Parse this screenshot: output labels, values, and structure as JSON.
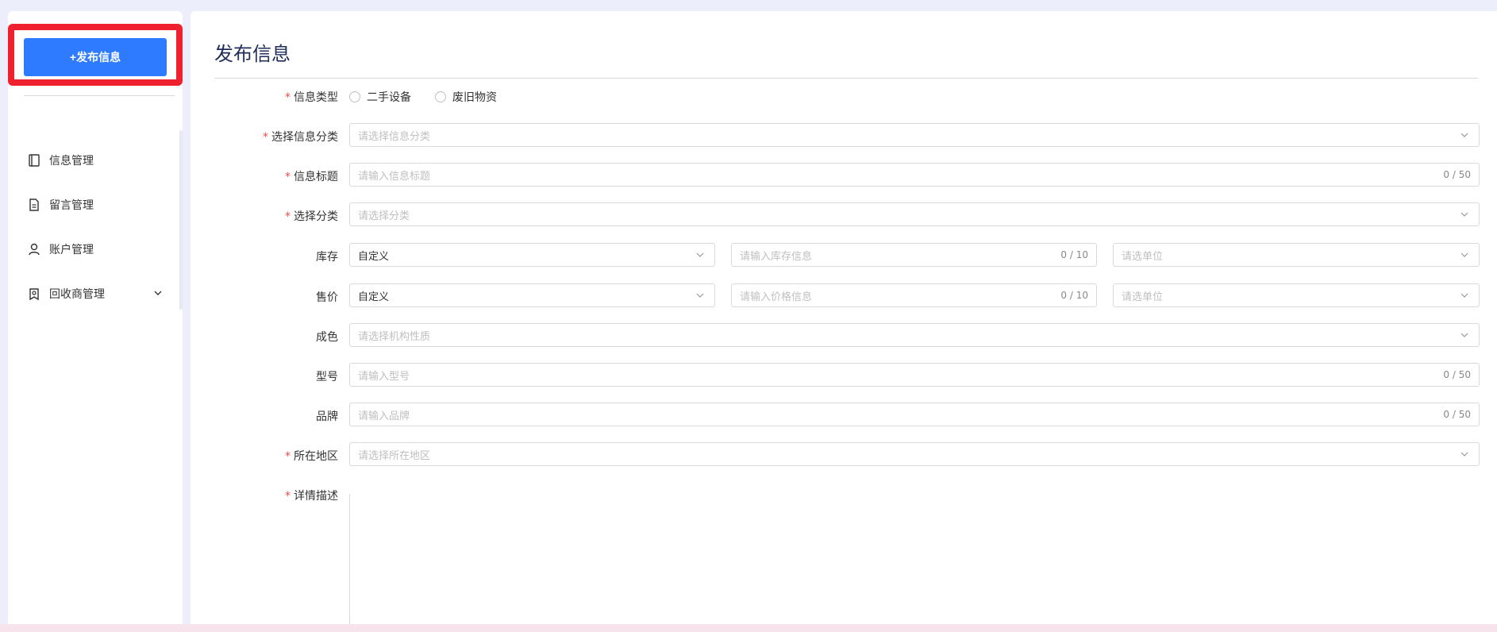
{
  "sidebar": {
    "publish_label": "+发布信息",
    "items": [
      {
        "label": "信息管理",
        "icon": "book-icon"
      },
      {
        "label": "留言管理",
        "icon": "document-icon"
      },
      {
        "label": "账户管理",
        "icon": "user-icon"
      },
      {
        "label": "回收商管理",
        "icon": "badge-icon",
        "has_submenu": true
      }
    ]
  },
  "main": {
    "title": "发布信息",
    "form": {
      "info_type": {
        "label": "信息类型",
        "required": true,
        "options": [
          "二手设备",
          "废旧物资"
        ]
      },
      "info_category": {
        "label": "选择信息分类",
        "required": true,
        "placeholder": "请选择信息分类"
      },
      "info_title": {
        "label": "信息标题",
        "required": true,
        "placeholder": "请输入信息标题",
        "counter": "0 / 50"
      },
      "category": {
        "label": "选择分类",
        "required": true,
        "placeholder": "请选择分类"
      },
      "stock": {
        "label": "库存",
        "mode_value": "自定义",
        "input_placeholder": "请输入库存信息",
        "input_counter": "0 / 10",
        "unit_placeholder": "请选单位"
      },
      "price": {
        "label": "售价",
        "mode_value": "自定义",
        "input_placeholder": "请输入价格信息",
        "input_counter": "0 / 10",
        "unit_placeholder": "请选单位"
      },
      "condition": {
        "label": "成色",
        "placeholder": "请选择机构性质"
      },
      "model": {
        "label": "型号",
        "placeholder": "请输入型号",
        "counter": "0 / 50"
      },
      "brand": {
        "label": "品牌",
        "placeholder": "请输入品牌",
        "counter": "0 / 50"
      },
      "region": {
        "label": "所在地区",
        "required": true,
        "placeholder": "请选择所在地区"
      },
      "description": {
        "label": "详情描述",
        "required": true
      }
    }
  },
  "colors": {
    "accent": "#2f7bff",
    "highlight": "#f0212e",
    "required": "#f54a45"
  }
}
